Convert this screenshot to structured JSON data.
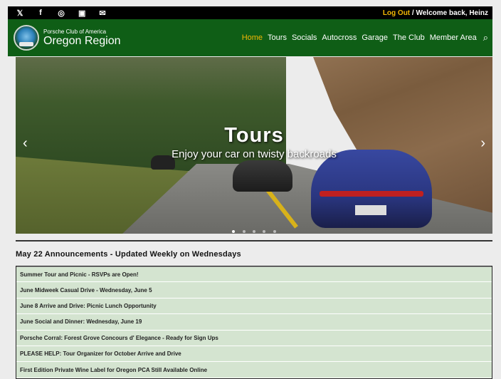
{
  "topbar": {
    "social_icons": [
      "twitter-icon",
      "facebook-icon",
      "instagram-icon",
      "youtube-icon",
      "mail-icon"
    ],
    "logout_label": "Log Out",
    "welcome_text": " / Welcome back, Heinz"
  },
  "nav": {
    "brand_small": "Porsche Club of America",
    "brand_big": "Oregon Region",
    "items": [
      {
        "label": "Home",
        "active": true
      },
      {
        "label": "Tours"
      },
      {
        "label": "Socials"
      },
      {
        "label": "Autocross"
      },
      {
        "label": "Garage"
      },
      {
        "label": "The Club"
      },
      {
        "label": "Member Area"
      }
    ]
  },
  "hero": {
    "title": "Tours",
    "subtitle": "Enjoy your car on twisty backroads"
  },
  "announcements": {
    "heading": "May 22 Announcements - Updated Weekly on Wednesdays",
    "items": [
      "Summer Tour and Picnic - RSVPs are Open!",
      "June Midweek Casual Drive - Wednesday, June 5",
      "June 8 Arrive and Drive: Picnic Lunch Opportunity",
      "June Social and Dinner: Wednesday, June 19",
      "Porsche Corral: Forest Grove Concours d' Elegance - Ready for Sign Ups",
      "PLEASE HELP: Tour Organizer for October Arrive and Drive",
      "First Edition Private Wine Label for Oregon PCA Still Available Online"
    ]
  },
  "colors": {
    "nav_green": "#0f5e16",
    "accent_yellow": "#f2b705",
    "announcement_bg": "#d4e4d0"
  }
}
